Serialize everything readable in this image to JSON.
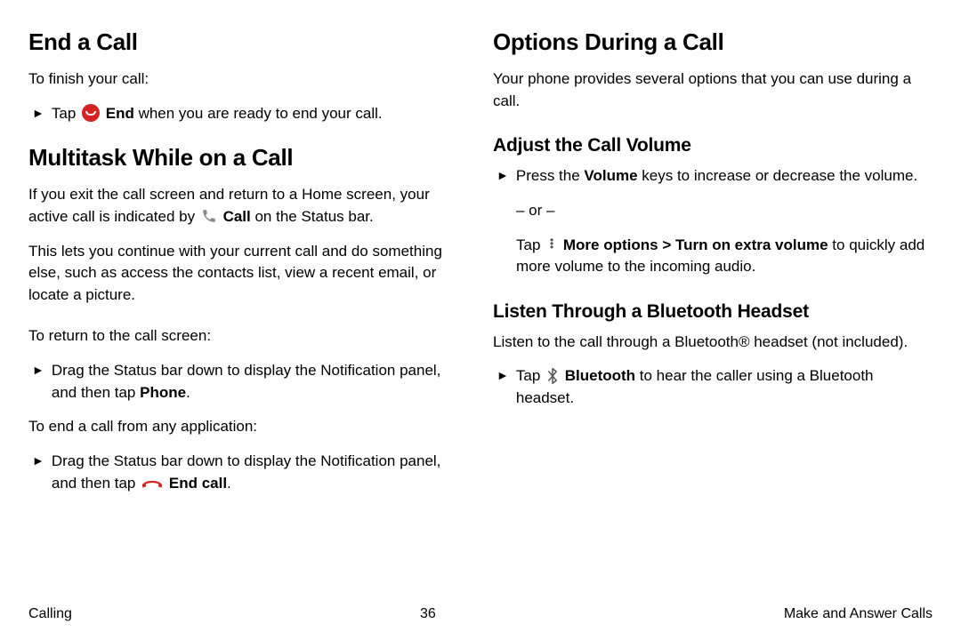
{
  "left": {
    "h_end": "End a Call",
    "p_finish": "To finish your call:",
    "b_tap": "Tap ",
    "b_end_bold": "End",
    "b_end_rest": " when you are ready to end your call.",
    "h_multi": "Multitask While on a Call",
    "p_exit_a": "If you exit the call screen and return to a Home screen, your active call is indicated by ",
    "p_exit_call_b": "Call",
    "p_exit_c": " on the Status bar.",
    "p_lets": "This lets you continue with your current call and do something else, such as access the contacts list, view a recent email, or locate a picture.",
    "p_return": "To return to the call screen:",
    "b_drag1_a": "Drag the Status bar down to display the Notification panel, and then tap ",
    "b_drag1_bold": "Phone",
    "b_drag1_c": ".",
    "p_endany": "To end a call from any application:",
    "b_drag2_a": "Drag the Status bar down to display the Notification panel, and then tap ",
    "b_drag2_bold": "End call",
    "b_drag2_c": "."
  },
  "right": {
    "h_opts": "Options During a Call",
    "p_intro": "Your phone provides several options that you can use during a call.",
    "h_vol": "Adjust the Call Volume",
    "b_vol_a": "Press the ",
    "b_vol_bold": "Volume",
    "b_vol_c": " keys to increase or decrease the volume.",
    "or": "– or –",
    "b_more_a": "Tap ",
    "b_more_bold": "More options > Turn on extra volume",
    "b_more_c": " to quickly add more volume to the incoming audio.",
    "h_bt": "Listen Through a Bluetooth Headset",
    "p_bt": "Listen to the call through a Bluetooth® headset (not included).",
    "b_bt_a": "Tap ",
    "b_bt_bold": "Bluetooth",
    "b_bt_c": " to hear the caller using a Bluetooth headset."
  },
  "footer": {
    "left": "Calling",
    "center": "36",
    "right": "Make and Answer Calls"
  },
  "marker": "►"
}
